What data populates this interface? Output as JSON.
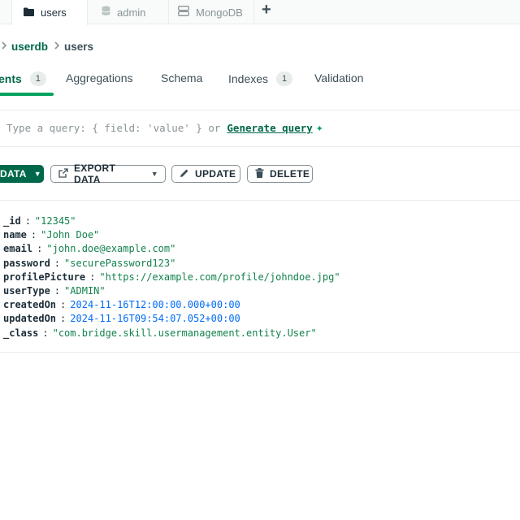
{
  "tabs": [
    {
      "label": "users",
      "icon": "folder-icon"
    },
    {
      "label": "admin",
      "icon": "database-icon"
    },
    {
      "label": "MongoDB",
      "icon": "server-icon"
    }
  ],
  "new_tab_label": "+",
  "breadcrumb": {
    "db": "userdb",
    "collection": "users"
  },
  "subtabs": [
    {
      "label": "ents",
      "count": "1"
    },
    {
      "label": "Aggregations"
    },
    {
      "label": "Schema"
    },
    {
      "label": "Indexes",
      "count": "1"
    },
    {
      "label": "Validation"
    }
  ],
  "query": {
    "placeholder": "Type a query: { field: 'value' } or",
    "generate_label": "Generate query",
    "sparkle": "✦"
  },
  "toolbar": {
    "add_label": "DATA",
    "export_label": "EXPORT DATA",
    "update_label": "UPDATE",
    "delete_label": "DELETE"
  },
  "document": [
    {
      "key": "_id",
      "value": "\"12345\"",
      "type": "string"
    },
    {
      "key": "name",
      "value": "\"John Doe\"",
      "type": "string"
    },
    {
      "key": "email",
      "value": "\"john.doe@example.com\"",
      "type": "string"
    },
    {
      "key": "password",
      "value": "\"securePassword123\"",
      "type": "string"
    },
    {
      "key": "profilePicture",
      "value": "\"https://example.com/profile/johndoe.jpg\"",
      "type": "string"
    },
    {
      "key": "userType",
      "value": "\"ADMIN\"",
      "type": "string"
    },
    {
      "key": "createdOn",
      "value": "2024-11-16T12:00:00.000+00:00",
      "type": "date"
    },
    {
      "key": "updatedOn",
      "value": "2024-11-16T09:54:07.052+00:00",
      "type": "date"
    },
    {
      "key": "_class",
      "value": "\"com.bridge.skill.usermanagement.entity.User\"",
      "type": "string"
    }
  ],
  "colors": {
    "accent": "#00684a",
    "accent_light": "#00a35c",
    "string": "#12824d",
    "date": "#016bf8"
  }
}
